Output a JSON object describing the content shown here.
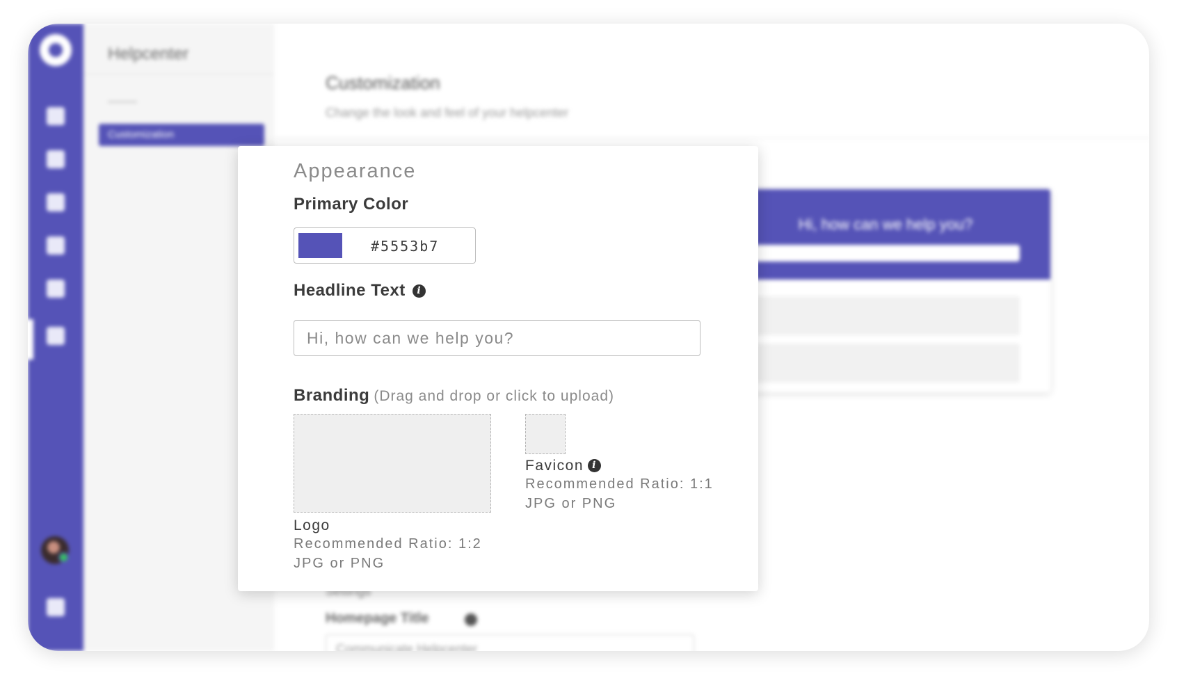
{
  "sidebar": {
    "accent_color": "#5553b7",
    "nav_icons": [
      "nav-icon-1",
      "nav-icon-2",
      "nav-icon-3",
      "nav-icon-4",
      "nav-icon-5",
      "nav-icon-6",
      "nav-icon-7"
    ]
  },
  "subnav": {
    "title": "Helpcenter",
    "section_label": "———",
    "active_item": "Customization"
  },
  "main": {
    "title": "Customization",
    "subtitle": "Change the look and feel of your helpcenter",
    "preview": {
      "headline": "Hi, how can we help you?"
    },
    "settings_label": "Settings",
    "homepage_title_label": "Homepage Title",
    "homepage_title_value": "Communicate Helpcenter"
  },
  "panel": {
    "title": "Appearance",
    "primary_color": {
      "label": "Primary Color",
      "value": "#5553b7",
      "swatch_color": "#5553b7"
    },
    "headline": {
      "label": "Headline Text",
      "placeholder": "Hi, how can we help you?"
    },
    "branding": {
      "label": "Branding",
      "hint": "(Drag and drop or click to upload)",
      "logo": {
        "name": "Logo",
        "ratio": "Recommended Ratio: 1:2",
        "formats": "JPG or PNG"
      },
      "favicon": {
        "name": "Favicon",
        "ratio": "Recommended Ratio: 1:1",
        "formats": "JPG or PNG"
      }
    }
  }
}
